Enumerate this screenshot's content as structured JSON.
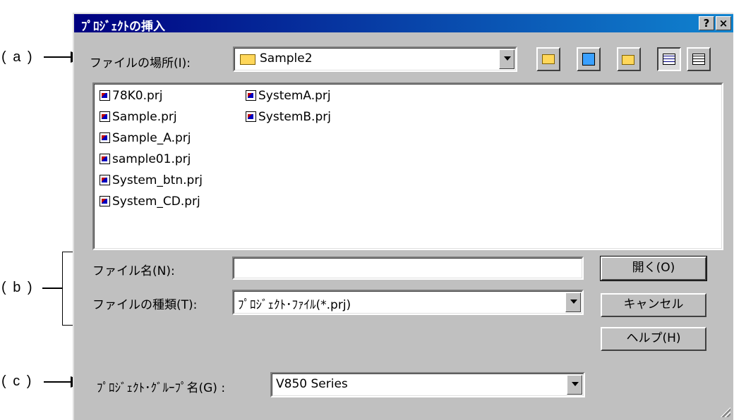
{
  "annotations": {
    "a": "( a )",
    "b": "( b )",
    "c": "( c )"
  },
  "dialog": {
    "title": "ﾌﾟﾛｼﾞｪｸﾄの挿入",
    "help_button": "?",
    "close_button": "×"
  },
  "look_in": {
    "label": "ファイルの場所(I):",
    "value": "Sample2"
  },
  "toolbar": [
    "up-one-level",
    "desktop",
    "create-new-folder",
    "list-view",
    "details-view"
  ],
  "files": {
    "column1": [
      "78K0.prj",
      "Sample.prj",
      "Sample_A.prj",
      "sample01.prj",
      "System_btn.prj",
      "System_CD.prj"
    ],
    "column2": [
      "SystemA.prj",
      "SystemB.prj"
    ]
  },
  "file_name": {
    "label": "ファイル名(N):",
    "value": ""
  },
  "file_type": {
    "label": "ファイルの種類(T):",
    "value": "ﾌﾟﾛｼﾞｪｸﾄ･ﾌｧｲﾙ(*.prj)"
  },
  "buttons": {
    "open": "開く(O)",
    "cancel": "キャンセル",
    "help": "ヘルプ(H)"
  },
  "group_name": {
    "label": "ﾌﾟﾛｼﾞｪｸﾄ･ｸﾞﾙｰﾌﾟ名(G) :",
    "value": "V850 Series"
  }
}
